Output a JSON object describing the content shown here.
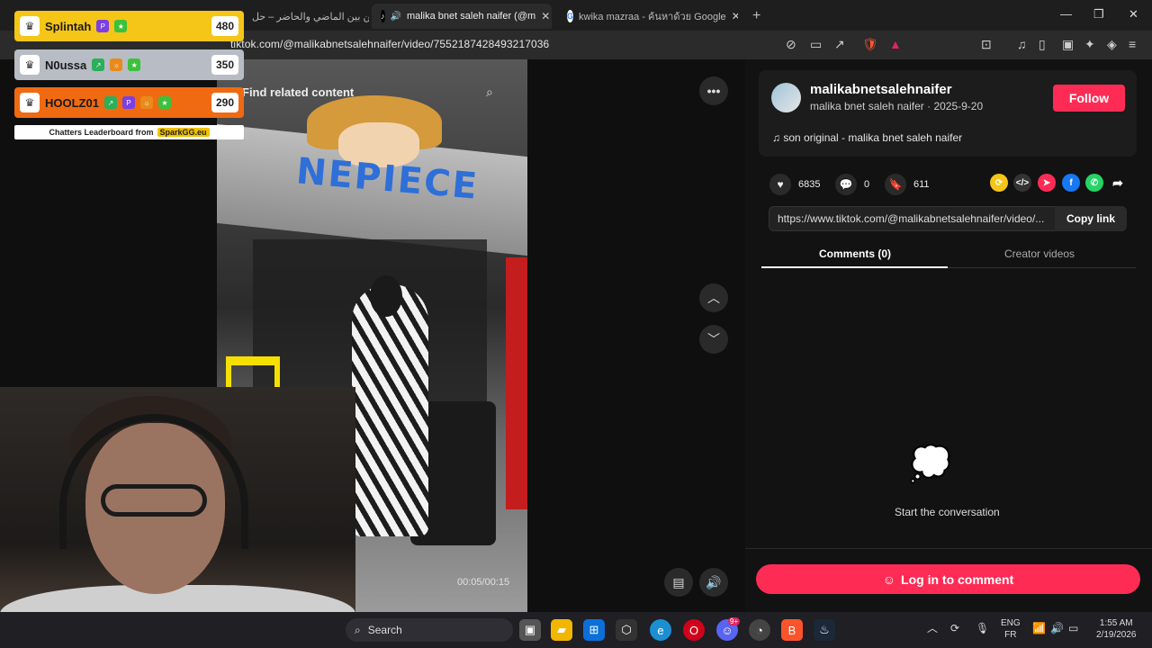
{
  "tabs": [
    {
      "title": "مدبلين بين الماضي والحاضر – حل",
      "active": false
    },
    {
      "title": "malika bnet saleh naifer (@m",
      "active": true
    },
    {
      "title": "kwika mazraa - ค้นหาด้วย Google",
      "active": false
    }
  ],
  "address": {
    "url": "tiktok.com/@malikabnetsalehnaifer/video/7552187428493217036"
  },
  "video": {
    "related_placeholder": "Find related content",
    "sign": "NEPIECE",
    "time": "00:05/00:15"
  },
  "creator": {
    "username": "malikabnetsalehnaifer",
    "display_name": "malika bnet saleh naifer",
    "date": "2025-9-20",
    "sep": "·",
    "follow_label": "Follow",
    "music": "son original - malika bnet saleh naifer"
  },
  "stats": {
    "likes": "6835",
    "comments": "0",
    "saves": "611"
  },
  "link": {
    "url": "https://www.tiktok.com/@malikabnetsalehnaifer/video/...",
    "copy_label": "Copy link"
  },
  "comment_tabs": {
    "comments": "Comments (0)",
    "creator_videos": "Creator videos"
  },
  "empty_state": "Start the conversation",
  "login_label": "Log in to comment",
  "leaderboard": {
    "rows": [
      {
        "name": "Splintah",
        "score": "480",
        "color": "#f5c518"
      },
      {
        "name": "N0ussa",
        "score": "350",
        "color": "#b8bcc4"
      },
      {
        "name": "HOOLZ01",
        "score": "290",
        "color": "#f06a12"
      }
    ],
    "footer": "Chatters Leaderboard from",
    "brand": "SparkGG.eu"
  },
  "taskbar": {
    "search": "Search",
    "lang_top": "ENG",
    "lang_bottom": "FR",
    "time": "1:55 AM",
    "date": "2/19/2026",
    "discord_badge": "9+"
  },
  "colors": {
    "accent": "#fe2c55",
    "bg": "#121212"
  }
}
